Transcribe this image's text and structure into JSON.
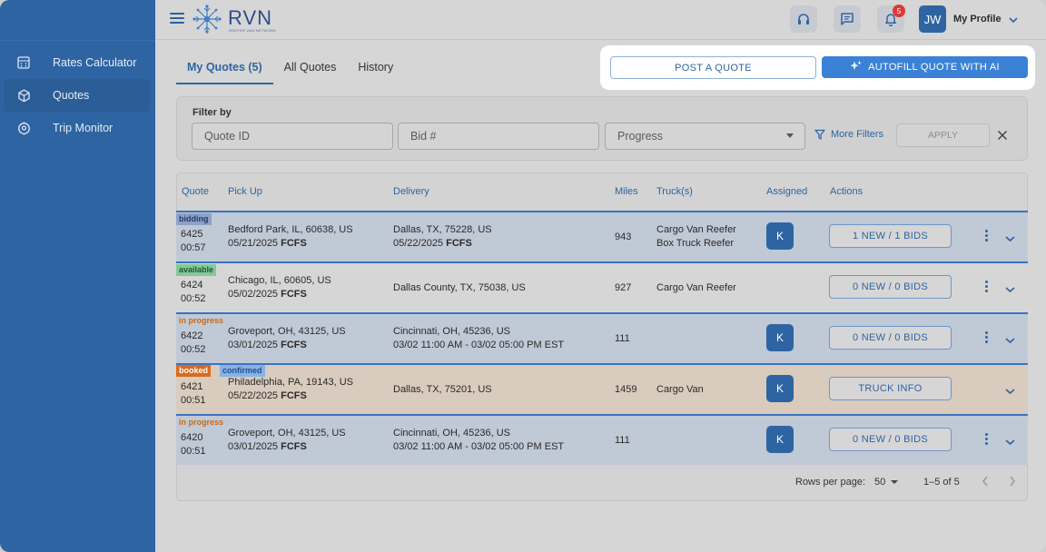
{
  "brand": {
    "name": "RVN",
    "tagline": "REEFER VAN NETWORK"
  },
  "header": {
    "notifications_count": "5",
    "avatar_initials": "JW",
    "profile_label": "My Profile"
  },
  "sidebar": {
    "items": [
      {
        "label": "Rates Calculator",
        "icon": "calculator-icon"
      },
      {
        "label": "Quotes",
        "icon": "cube-icon"
      },
      {
        "label": "Trip Monitor",
        "icon": "location-icon"
      }
    ]
  },
  "tabs": [
    "My Quotes (5)",
    "All Quotes",
    "History"
  ],
  "actions": {
    "post_label": "POST A QUOTE",
    "autofill_label": "AUTOFILL QUOTE WITH AI"
  },
  "filter": {
    "label": "Filter by",
    "quote_id_placeholder": "Quote ID",
    "bid_placeholder": "Bid #",
    "progress_placeholder": "Progress",
    "more_filters": "More Filters",
    "apply": "APPLY"
  },
  "table": {
    "columns": [
      "Quote",
      "Pick Up",
      "Delivery",
      "Miles",
      "Truck(s)",
      "Assigned",
      "Actions"
    ],
    "rows": [
      {
        "status": "bidding",
        "id": "6425",
        "time": "00:57",
        "pickup": "Bedford Park, IL, 60638, US",
        "pickup_date": "05/21/2025",
        "pickup_tag": "FCFS",
        "delivery": "Dallas, TX, 75228, US",
        "delivery_date": "05/22/2025",
        "delivery_tag": "FCFS",
        "miles": "943",
        "truck1": "Cargo Van Reefer",
        "truck2": "Box Truck Reefer",
        "assigned": "K",
        "action": "1 NEW / 1 BIDS"
      },
      {
        "status": "available",
        "id": "6424",
        "time": "00:52",
        "pickup": "Chicago, IL, 60605, US",
        "pickup_date": "05/02/2025",
        "pickup_tag": "FCFS",
        "delivery": "Dallas County, TX, 75038, US",
        "miles": "927",
        "truck1": "Cargo Van Reefer",
        "action": "0 NEW / 0 BIDS"
      },
      {
        "status": "in progress",
        "id": "6422",
        "time": "00:52",
        "pickup": "Groveport, OH, 43125, US",
        "pickup_date": "03/01/2025",
        "pickup_tag": "FCFS",
        "delivery": "Cincinnati, OH, 45236, US",
        "delivery_window": "03/02 11:00 AM - 03/02 05:00 PM EST",
        "miles": "111",
        "assigned": "K",
        "action": "0 NEW / 0 BIDS"
      },
      {
        "status": "booked",
        "status2": "confirmed",
        "id": "6421",
        "time": "00:51",
        "pickup": "Philadelphia, PA, 19143, US",
        "pickup_date": "05/22/2025",
        "pickup_tag": "FCFS",
        "delivery": "Dallas, TX, 75201, US",
        "miles": "1459",
        "truck1": "Cargo Van",
        "assigned": "K",
        "action": "TRUCK INFO"
      },
      {
        "status": "in progress",
        "id": "6420",
        "time": "00:51",
        "pickup": "Groveport, OH, 43125, US",
        "pickup_date": "03/01/2025",
        "pickup_tag": "FCFS",
        "delivery": "Cincinnati, OH, 45236, US",
        "delivery_window": "03/02 11:00 AM - 03/02 05:00 PM EST",
        "miles": "111",
        "assigned": "K",
        "action": "0 NEW / 0 BIDS"
      }
    ]
  },
  "pagination": {
    "rows_per_page_label": "Rows per page:",
    "rows_per_page": "50",
    "range": "1–5 of 5"
  },
  "colors": {
    "primary": "#2e64a2",
    "accent": "#3b82d6",
    "booked": "#d86b1d",
    "badge": "#d93a3a"
  }
}
